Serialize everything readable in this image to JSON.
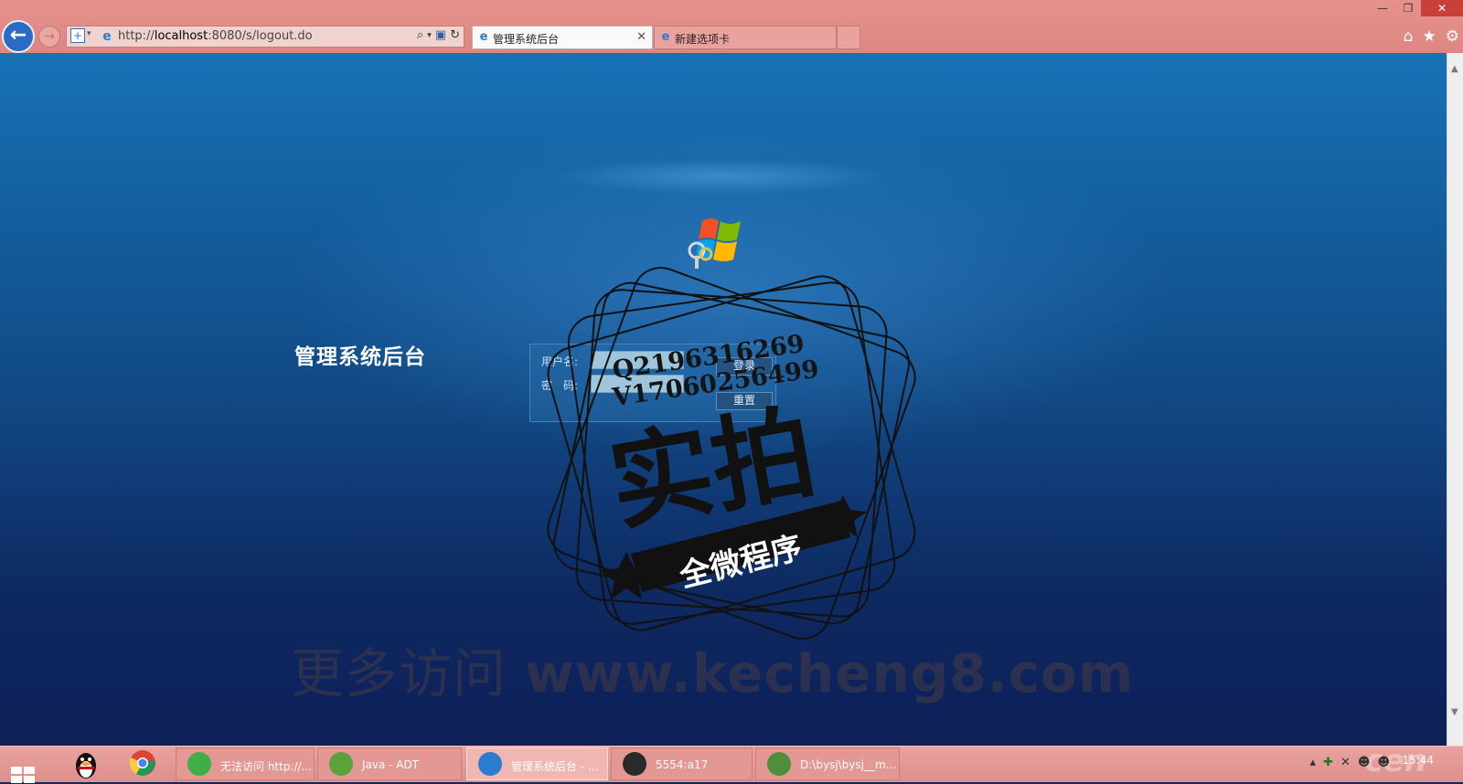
{
  "browser": {
    "url_prefix": "http://",
    "url_host": "localhost",
    "url_rest": ":8080/s/logout.do",
    "tabs": [
      {
        "title": "管理系统后台",
        "active": true
      },
      {
        "title": "新建选项卡",
        "active": false
      }
    ]
  },
  "page": {
    "title": "管理系统后台",
    "login": {
      "username_label": "用户名:",
      "password_label": "密　码:",
      "login_button": "登录",
      "reset_button": "重置"
    }
  },
  "watermark": {
    "qq": "Q2196316269",
    "wechat": "V17060256499",
    "stamp_main": "实拍",
    "stamp_ribbon": "全微程序",
    "bottom_cn": "更多访问",
    "bottom_url": "www.kecheng8.com"
  },
  "taskbar": {
    "tasks": [
      {
        "label": "无法访问 http://...",
        "color": "#3fae49"
      },
      {
        "label": "Java - ADT",
        "color": "#5aa33a"
      },
      {
        "label": "管理系统后台 - ...",
        "color": "#2a7ccf"
      },
      {
        "label": "5554:a17",
        "color": "#2a2a2a"
      },
      {
        "label": "D:\\bysj\\bysj__m...",
        "color": "#4d8f3a"
      }
    ],
    "clock": "15:44",
    "colors": {
      "taskbar": "#de8f8b",
      "accent": "#2a6cc4"
    }
  }
}
